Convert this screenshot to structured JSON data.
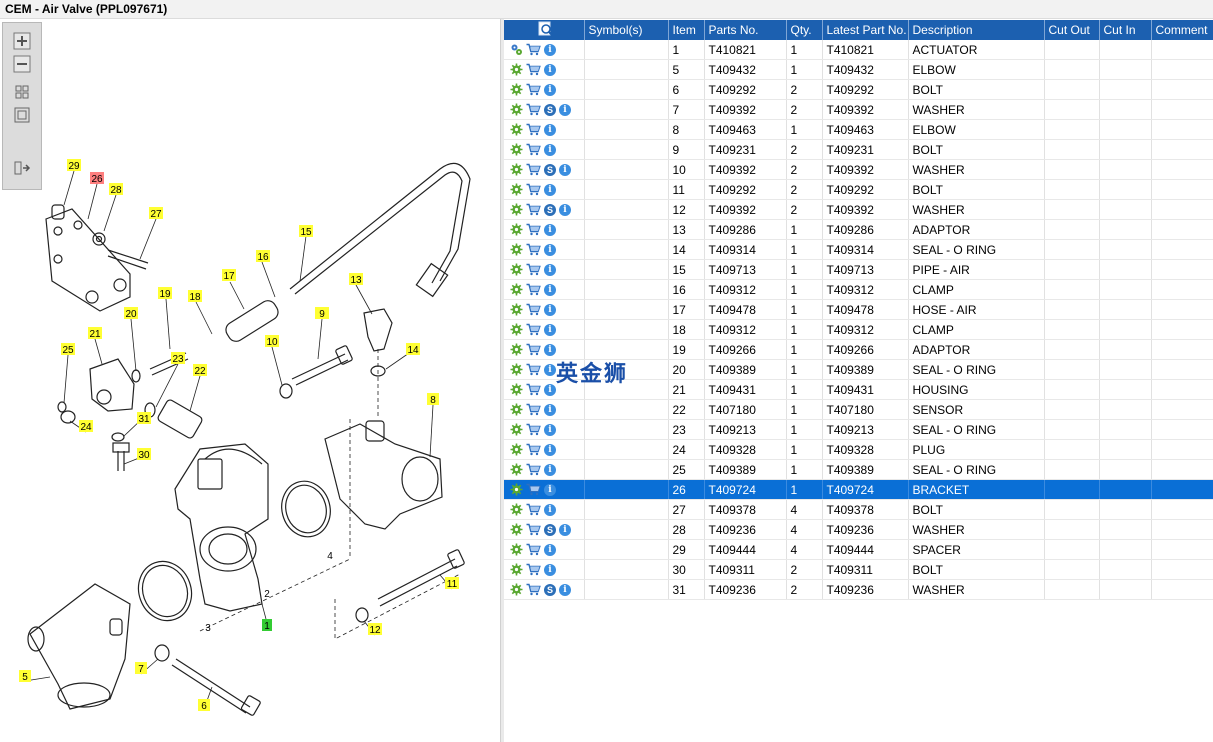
{
  "title": "CEM - Air Valve (PPL097671)",
  "columns": [
    "Symbol(s)",
    "Item",
    "Parts No.",
    "Qty.",
    "Latest Part No.",
    "Description",
    "Cut Out",
    "Cut In",
    "Comment"
  ],
  "rows": [
    {
      "item": "1",
      "part": "T410821",
      "qty": "1",
      "latest": "T410821",
      "desc": "ACTUATOR",
      "s": false,
      "first": true
    },
    {
      "item": "5",
      "part": "T409432",
      "qty": "1",
      "latest": "T409432",
      "desc": "ELBOW",
      "s": false
    },
    {
      "item": "6",
      "part": "T409292",
      "qty": "2",
      "latest": "T409292",
      "desc": "BOLT",
      "s": false
    },
    {
      "item": "7",
      "part": "T409392",
      "qty": "2",
      "latest": "T409392",
      "desc": "WASHER",
      "s": true
    },
    {
      "item": "8",
      "part": "T409463",
      "qty": "1",
      "latest": "T409463",
      "desc": "ELBOW",
      "s": false
    },
    {
      "item": "9",
      "part": "T409231",
      "qty": "2",
      "latest": "T409231",
      "desc": "BOLT",
      "s": false
    },
    {
      "item": "10",
      "part": "T409392",
      "qty": "2",
      "latest": "T409392",
      "desc": "WASHER",
      "s": true
    },
    {
      "item": "11",
      "part": "T409292",
      "qty": "2",
      "latest": "T409292",
      "desc": "BOLT",
      "s": false
    },
    {
      "item": "12",
      "part": "T409392",
      "qty": "2",
      "latest": "T409392",
      "desc": "WASHER",
      "s": true
    },
    {
      "item": "13",
      "part": "T409286",
      "qty": "1",
      "latest": "T409286",
      "desc": "ADAPTOR",
      "s": false
    },
    {
      "item": "14",
      "part": "T409314",
      "qty": "1",
      "latest": "T409314",
      "desc": "SEAL - O RING",
      "s": false
    },
    {
      "item": "15",
      "part": "T409713",
      "qty": "1",
      "latest": "T409713",
      "desc": "PIPE - AIR",
      "s": false
    },
    {
      "item": "16",
      "part": "T409312",
      "qty": "1",
      "latest": "T409312",
      "desc": "CLAMP",
      "s": false
    },
    {
      "item": "17",
      "part": "T409478",
      "qty": "1",
      "latest": "T409478",
      "desc": "HOSE - AIR",
      "s": false
    },
    {
      "item": "18",
      "part": "T409312",
      "qty": "1",
      "latest": "T409312",
      "desc": "CLAMP",
      "s": false
    },
    {
      "item": "19",
      "part": "T409266",
      "qty": "1",
      "latest": "T409266",
      "desc": "ADAPTOR",
      "s": false
    },
    {
      "item": "20",
      "part": "T409389",
      "qty": "1",
      "latest": "T409389",
      "desc": "SEAL - O RING",
      "s": false
    },
    {
      "item": "21",
      "part": "T409431",
      "qty": "1",
      "latest": "T409431",
      "desc": "HOUSING",
      "s": false
    },
    {
      "item": "22",
      "part": "T407180",
      "qty": "1",
      "latest": "T407180",
      "desc": "SENSOR",
      "s": false
    },
    {
      "item": "23",
      "part": "T409213",
      "qty": "1",
      "latest": "T409213",
      "desc": "SEAL - O RING",
      "s": false
    },
    {
      "item": "24",
      "part": "T409328",
      "qty": "1",
      "latest": "T409328",
      "desc": "PLUG",
      "s": false
    },
    {
      "item": "25",
      "part": "T409389",
      "qty": "1",
      "latest": "T409389",
      "desc": "SEAL - O RING",
      "s": false
    },
    {
      "item": "26",
      "part": "T409724",
      "qty": "1",
      "latest": "T409724",
      "desc": "BRACKET",
      "s": false,
      "selected": true
    },
    {
      "item": "27",
      "part": "T409378",
      "qty": "4",
      "latest": "T409378",
      "desc": "BOLT",
      "s": false
    },
    {
      "item": "28",
      "part": "T409236",
      "qty": "4",
      "latest": "T409236",
      "desc": "WASHER",
      "s": true
    },
    {
      "item": "29",
      "part": "T409444",
      "qty": "4",
      "latest": "T409444",
      "desc": "SPACER",
      "s": false
    },
    {
      "item": "30",
      "part": "T409311",
      "qty": "2",
      "latest": "T409311",
      "desc": "BOLT",
      "s": false
    },
    {
      "item": "31",
      "part": "T409236",
      "qty": "2",
      "latest": "T409236",
      "desc": "WASHER",
      "s": true
    }
  ],
  "watermark": "英金狮",
  "callouts": [
    "29",
    "26",
    "28",
    "27",
    "15",
    "16",
    "17",
    "18",
    "19",
    "20",
    "21",
    "13",
    "9",
    "10",
    "14",
    "25",
    "23",
    "22",
    "31",
    "24",
    "30",
    "8",
    "4",
    "2",
    "1",
    "3",
    "11",
    "12",
    "5",
    "7",
    "6"
  ],
  "icons": {
    "zoom_in": "zoom-in-icon",
    "zoom_out": "zoom-out-icon",
    "fit": "fit-page-icon",
    "actual": "actual-size-icon",
    "panel": "toggle-panel-icon",
    "header": "find-icon",
    "row_tools": [
      "gear-icon",
      "cart-icon",
      "info-icon",
      "s-icon"
    ]
  },
  "colors": {
    "header": "#1c60b0",
    "selected": "#0a6fd6",
    "callout": "#ffff33",
    "callout_selected": "#ff7f7f",
    "callout_root": "#33cc33"
  }
}
